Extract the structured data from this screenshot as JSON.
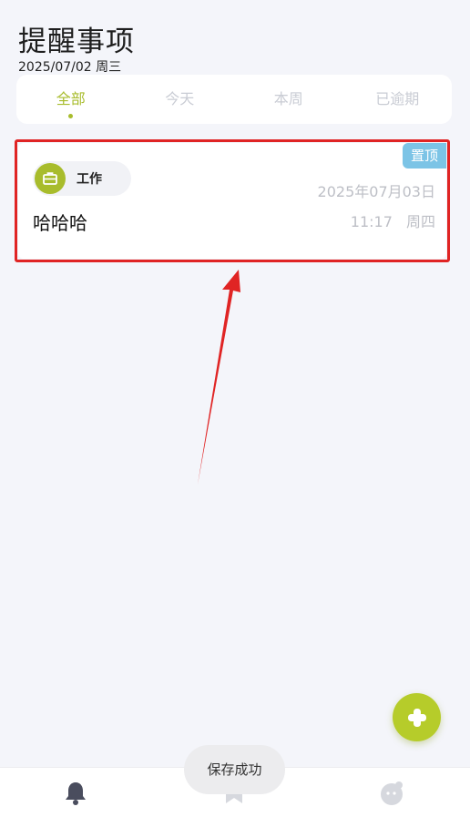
{
  "header": {
    "title": "提醒事项",
    "date": "2025/07/02 周三"
  },
  "tabs": [
    {
      "label": "全部",
      "active": true
    },
    {
      "label": "今天",
      "active": false
    },
    {
      "label": "本周",
      "active": false
    },
    {
      "label": "已逾期",
      "active": false
    }
  ],
  "reminder": {
    "pin_label": "置顶",
    "category": "工作",
    "date": "2025年07月03日",
    "title": "哈哈哈",
    "time": "11:17",
    "weekday": "周四"
  },
  "toast": "保存成功",
  "nav": [
    {
      "icon": "bell-icon",
      "active": true
    },
    {
      "icon": "bookmark-icon",
      "active": false
    },
    {
      "icon": "profile-face-icon",
      "active": false
    }
  ],
  "colors": {
    "accent": "#a8bc2c",
    "pin": "#7cc4e6",
    "highlight": "#e02424",
    "background": "#f4f5fa"
  }
}
